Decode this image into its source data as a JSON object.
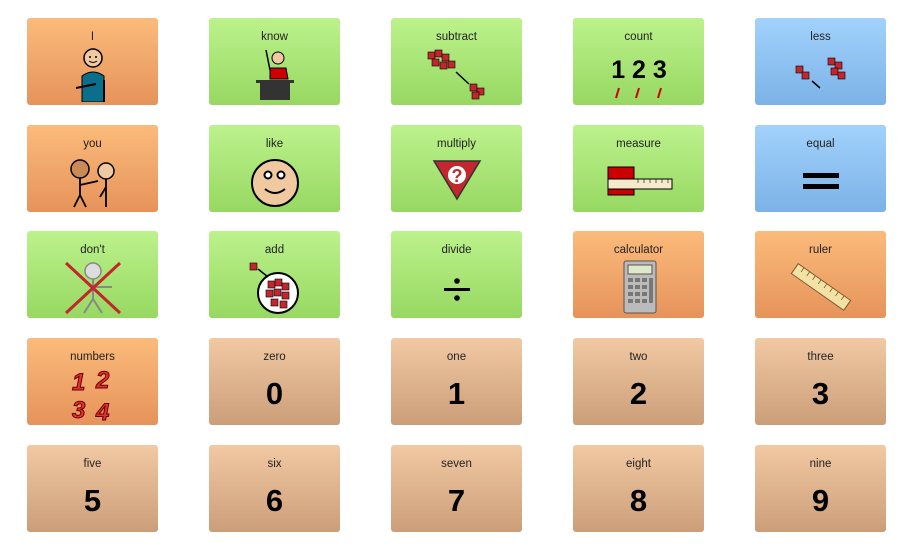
{
  "colors": {
    "orange": "#f0a466",
    "green": "#a9e577",
    "blue": "#8fc2f2",
    "tan": "#dfb48e"
  },
  "tiles": [
    {
      "label": "I",
      "color": "orange",
      "icon": "person-self-icon"
    },
    {
      "label": "know",
      "color": "green",
      "icon": "student-raising-hand-icon"
    },
    {
      "label": "subtract",
      "color": "green",
      "icon": "subtract-blocks-icon"
    },
    {
      "label": "count",
      "color": "green",
      "icon": "count-numbers-icon",
      "symbol": "1 2 3"
    },
    {
      "label": "less",
      "color": "blue",
      "icon": "less-blocks-icon"
    },
    {
      "label": "you",
      "color": "orange",
      "icon": "person-pointing-icon"
    },
    {
      "label": "like",
      "color": "green",
      "icon": "smiley-face-icon"
    },
    {
      "label": "multiply",
      "color": "green",
      "icon": "multiply-triangle-icon",
      "symbol": "?"
    },
    {
      "label": "measure",
      "color": "green",
      "icon": "tape-measure-icon"
    },
    {
      "label": "equal",
      "color": "blue",
      "icon": "equals-sign-icon"
    },
    {
      "label": "don't",
      "color": "green",
      "icon": "crossed-out-person-icon"
    },
    {
      "label": "add",
      "color": "green",
      "icon": "add-blocks-plate-icon"
    },
    {
      "label": "divide",
      "color": "green",
      "icon": "division-sign-icon"
    },
    {
      "label": "calculator",
      "color": "orange",
      "icon": "calculator-icon"
    },
    {
      "label": "ruler",
      "color": "orange",
      "icon": "ruler-icon"
    },
    {
      "label": "numbers",
      "color": "orange",
      "icon": "numbers-1234-icon",
      "symbol": "1 2 3 4"
    },
    {
      "label": "zero",
      "color": "tan",
      "numeral": "0"
    },
    {
      "label": "one",
      "color": "tan",
      "numeral": "1"
    },
    {
      "label": "two",
      "color": "tan",
      "numeral": "2"
    },
    {
      "label": "three",
      "color": "tan",
      "numeral": "3"
    },
    {
      "label": "five",
      "color": "tan",
      "numeral": "5"
    },
    {
      "label": "six",
      "color": "tan",
      "numeral": "6"
    },
    {
      "label": "seven",
      "color": "tan",
      "numeral": "7"
    },
    {
      "label": "eight",
      "color": "tan",
      "numeral": "8"
    },
    {
      "label": "nine",
      "color": "tan",
      "numeral": "9"
    }
  ]
}
